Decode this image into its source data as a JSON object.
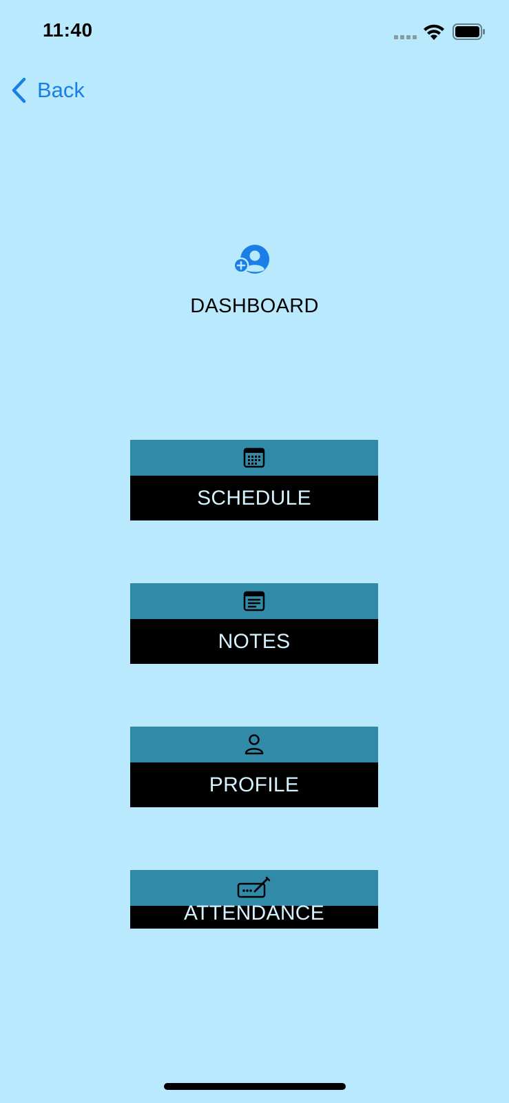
{
  "status_bar": {
    "time": "11:40"
  },
  "nav": {
    "back_label": "Back"
  },
  "header": {
    "title": "DASHBOARD",
    "icon": "person-add-icon"
  },
  "menu": [
    {
      "label": "SCHEDULE",
      "icon": "calendar-icon"
    },
    {
      "label": "NOTES",
      "icon": "notes-icon"
    },
    {
      "label": "PROFILE",
      "icon": "person-icon"
    },
    {
      "label": "ATTENDANCE",
      "icon": "signature-icon"
    }
  ],
  "colors": {
    "background": "#b9e9fc",
    "card_top": "#308aa8",
    "card_bottom": "#000000",
    "card_text": "#d6f2ff",
    "accent": "#1a7ee6"
  }
}
